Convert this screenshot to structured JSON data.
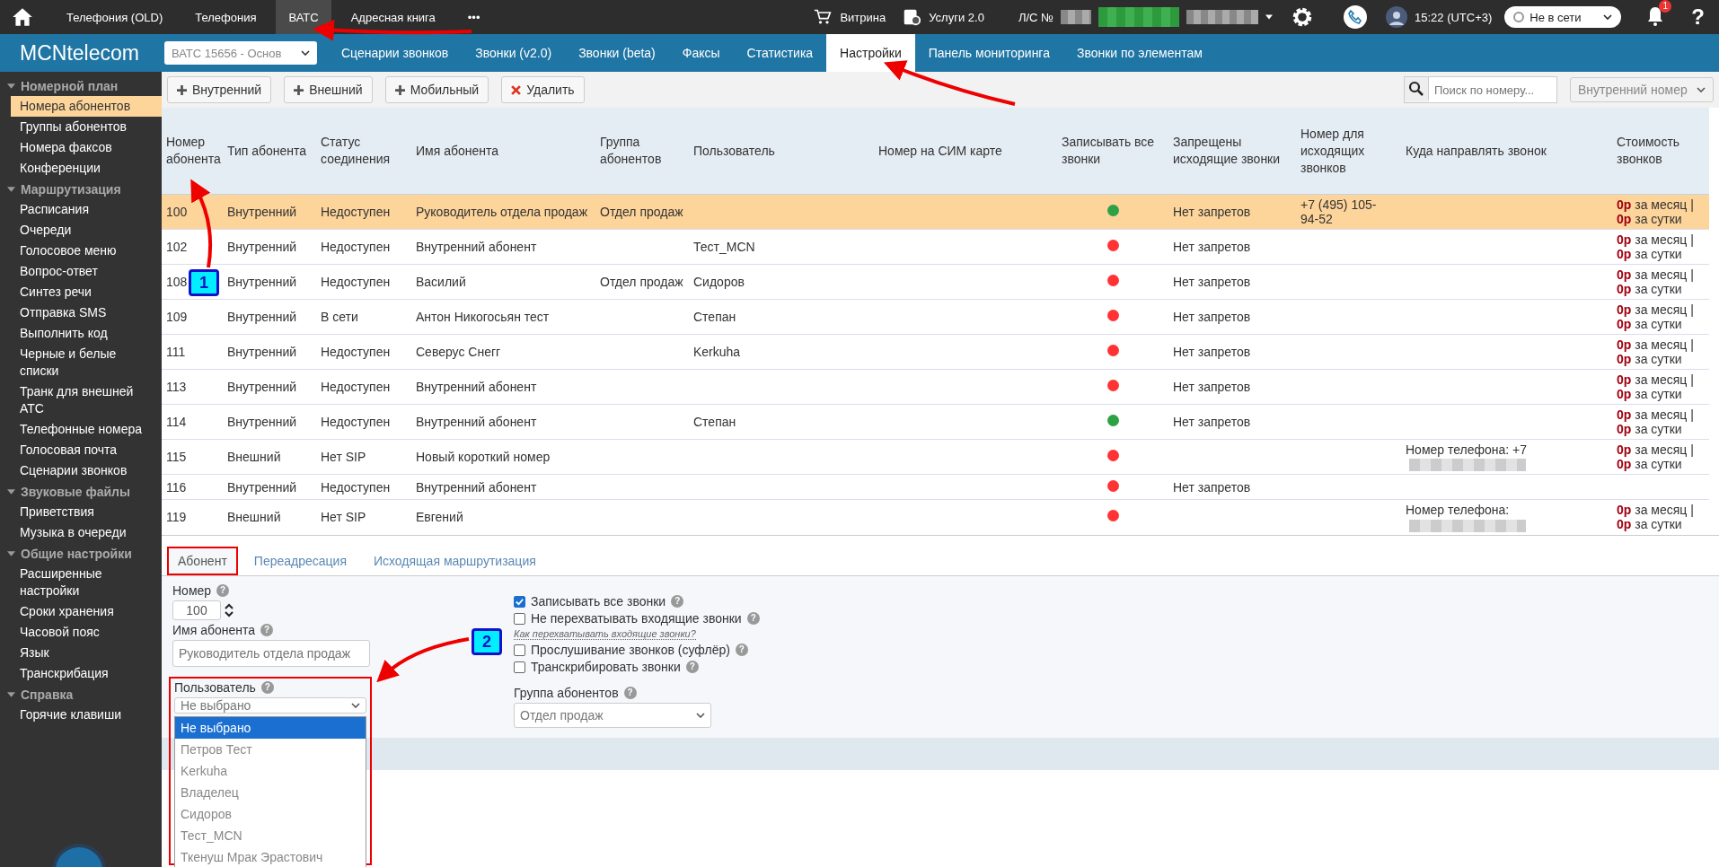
{
  "topbar": {
    "nav": [
      {
        "label": "Телефония (OLD)",
        "selected": false
      },
      {
        "label": "Телефония",
        "selected": false
      },
      {
        "label": "ВАТС",
        "selected": true
      },
      {
        "label": "Адресная книга",
        "selected": false
      },
      {
        "label": "•••",
        "selected": false
      }
    ],
    "showcase": "Витрина",
    "services": "Услуги 2.0",
    "account": "Л/С №",
    "time": "15:22 (UTC+3)",
    "status": "Не в сети",
    "notifications": "1",
    "help": "?"
  },
  "header": {
    "logo": "MCNtelecom",
    "pbx_select": "ВАТС 15656 - Основ",
    "tabs": [
      {
        "label": "Сценарии звонков",
        "selected": false
      },
      {
        "label": "Звонки (v2.0)",
        "selected": false
      },
      {
        "label": "Звонки (beta)",
        "selected": false
      },
      {
        "label": "Факсы",
        "selected": false
      },
      {
        "label": "Статистика",
        "selected": false
      },
      {
        "label": "Настройки",
        "selected": true
      },
      {
        "label": "Панель мониторинга",
        "selected": false
      },
      {
        "label": "Звонки по элементам",
        "selected": false
      }
    ]
  },
  "sidebar": {
    "groups": [
      {
        "title": "Номерной план",
        "expanded": true,
        "items": [
          {
            "label": "Номера абонентов",
            "selected": true
          },
          {
            "label": "Группы абонентов",
            "selected": false
          },
          {
            "label": "Номера факсов",
            "selected": false
          },
          {
            "label": "Конференции",
            "selected": false
          }
        ]
      },
      {
        "title": "Маршрутизация",
        "expanded": true,
        "items": [
          {
            "label": "Расписания",
            "selected": false
          },
          {
            "label": "Очереди",
            "selected": false
          },
          {
            "label": "Голосовое меню",
            "selected": false
          },
          {
            "label": "Вопрос-ответ",
            "selected": false
          },
          {
            "label": "Синтез речи",
            "selected": false
          },
          {
            "label": "Отправка SMS",
            "selected": false
          },
          {
            "label": "Выполнить код",
            "selected": false
          },
          {
            "label": "Черные и белые списки",
            "selected": false
          },
          {
            "label": "Транк для внешней АТС",
            "selected": false
          },
          {
            "label": "Телефонные номера",
            "selected": false
          },
          {
            "label": "Голосовая почта",
            "selected": false
          },
          {
            "label": "Сценарии звонков",
            "selected": false
          }
        ]
      },
      {
        "title": "Звуковые файлы",
        "expanded": true,
        "items": [
          {
            "label": "Приветствия",
            "selected": false
          },
          {
            "label": "Музыка в очереди",
            "selected": false
          }
        ]
      },
      {
        "title": "Общие настройки",
        "expanded": true,
        "items": [
          {
            "label": "Расширенные настройки",
            "selected": false
          },
          {
            "label": "Сроки хранения",
            "selected": false
          },
          {
            "label": "Часовой пояс",
            "selected": false
          },
          {
            "label": "Язык",
            "selected": false
          },
          {
            "label": "Транскрибация",
            "selected": false
          }
        ]
      },
      {
        "title": "Справка",
        "expanded": true,
        "items": [
          {
            "label": "Горячие клавиши",
            "selected": false
          }
        ]
      }
    ]
  },
  "toolbar": {
    "buttons": [
      {
        "label": "Внутренний",
        "kind": "add"
      },
      {
        "label": "Внешний",
        "kind": "add"
      },
      {
        "label": "Мобильный",
        "kind": "add"
      },
      {
        "label": "Удалить",
        "kind": "delete"
      }
    ],
    "search": {
      "placeholder": "Поиск по номеру..."
    },
    "filter": "Внутренний номер"
  },
  "table": {
    "columns": [
      "Номер абонента",
      "Тип абонента",
      "Статус соединения",
      "Имя абонента",
      "Группа абонентов",
      "Пользователь",
      "Номер на СИМ карте",
      "Записывать все звонки",
      "Запрещены исходящие звонки",
      "Номер для исходящих звонков",
      "Куда направлять звонок",
      "Стоимость звонков"
    ],
    "rows": [
      {
        "number": "100",
        "type": "Внутренний",
        "status": "Недоступен",
        "name": "Руководитель отдела продаж",
        "group": "Отдел продаж",
        "user": "",
        "record": true,
        "restrictions": "Нет запретов",
        "outgoing": "+7 (495) 105-94-52",
        "forward": "",
        "redacted": false,
        "cost": "**0р** за месяц | **0р** за сутки",
        "selected": true
      },
      {
        "number": "102",
        "type": "Внутренний",
        "status": "Недоступен",
        "name": "Внутренний абонент",
        "group": "",
        "user": "Тест_MCN",
        "record": false,
        "restrictions": "Нет запретов",
        "outgoing": "",
        "forward": "",
        "redacted": false,
        "cost": "**0р** за месяц | **0р** за сутки",
        "selected": false
      },
      {
        "number": "108",
        "type": "Внутренний",
        "status": "Недоступен",
        "name": "Василий",
        "group": "Отдел продаж",
        "user": "Сидоров",
        "record": false,
        "restrictions": "Нет запретов",
        "outgoing": "",
        "forward": "",
        "redacted": false,
        "cost": "**0р** за месяц | **0р** за сутки",
        "selected": false
      },
      {
        "number": "109",
        "type": "Внутренний",
        "status": "В сети",
        "name": "Антон Никогосьян тест",
        "group": "",
        "user": "Степан",
        "record": false,
        "restrictions": "Нет запретов",
        "outgoing": "",
        "forward": "",
        "redacted": false,
        "cost": "**0р** за месяц | **0р** за сутки",
        "selected": false
      },
      {
        "number": "111",
        "type": "Внутренний",
        "status": "Недоступен",
        "name": "Северус Снегг",
        "group": "",
        "user": "Kerkuha",
        "record": false,
        "restrictions": "Нет запретов",
        "outgoing": "",
        "forward": "",
        "redacted": false,
        "cost": "**0р** за месяц | **0р** за сутки",
        "selected": false
      },
      {
        "number": "113",
        "type": "Внутренний",
        "status": "Недоступен",
        "name": "Внутренний абонент",
        "group": "",
        "user": "",
        "record": false,
        "restrictions": "Нет запретов",
        "outgoing": "",
        "forward": "",
        "redacted": false,
        "cost": "**0р** за месяц | **0р** за сутки",
        "selected": false
      },
      {
        "number": "114",
        "type": "Внутренний",
        "status": "Недоступен",
        "name": "Внутренний абонент",
        "group": "",
        "user": "Степан",
        "record": true,
        "restrictions": "Нет запретов",
        "outgoing": "",
        "forward": "",
        "redacted": false,
        "cost": "**0р** за месяц | **0р** за сутки",
        "selected": false
      },
      {
        "number": "115",
        "type": "Внешний",
        "status": "Нет SIP",
        "name": "Новый короткий номер",
        "group": "",
        "user": "",
        "record": false,
        "restrictions": "",
        "outgoing": "",
        "forward": "Номер телефона: +7",
        "redacted": true,
        "cost": "**0р** за месяц | **0р** за сутки",
        "selected": false
      },
      {
        "number": "116",
        "type": "Внутренний",
        "status": "Недоступен",
        "name": "Внутренний абонент",
        "group": "",
        "user": "",
        "record": false,
        "restrictions": "Нет запретов",
        "outgoing": "",
        "forward": "",
        "redacted": false,
        "cost": "",
        "selected": false
      },
      {
        "number": "119",
        "type": "Внешний",
        "status": "Нет SIP",
        "name": "Евгений",
        "group": "",
        "user": "",
        "record": false,
        "restrictions": "",
        "outgoing": "",
        "forward": "Номер телефона:",
        "redacted": true,
        "cost": "**0р** за месяц | **0р** за сутки",
        "selected": false
      }
    ]
  },
  "details": {
    "tabs": [
      {
        "label": "Абонент",
        "selected": true,
        "highlighted": true
      },
      {
        "label": "Переадресация",
        "selected": false,
        "highlighted": false
      },
      {
        "label": "Исходящая маршрутизация",
        "selected": false,
        "highlighted": false
      }
    ],
    "number": {
      "label": "Номер",
      "help": "?",
      "value": "100"
    },
    "name": {
      "label": "Имя абонента",
      "help": "?",
      "placeholder": "Руководитель отдела продаж"
    },
    "user": {
      "label": "Пользователь",
      "help": "?",
      "value": "Не выбрано",
      "highlighted": true,
      "options": [
        {
          "label": "Не выбрано",
          "selected": true
        },
        {
          "label": "Петров Тест",
          "selected": false
        },
        {
          "label": "Kerkuha",
          "selected": false
        },
        {
          "label": "Владелец",
          "selected": false
        },
        {
          "label": "Сидоров",
          "selected": false
        },
        {
          "label": "Тест_MCN",
          "selected": false
        },
        {
          "label": "Ткенуш Мрак Эрастович",
          "selected": false
        }
      ]
    },
    "options": [
      {
        "kind": "checkbox",
        "label": "Записывать все звонки",
        "help": "?",
        "checked": true
      },
      {
        "kind": "checkbox",
        "label": "Не перехватывать входящие звонки",
        "help": "?",
        "checked": false
      },
      {
        "kind": "link",
        "label": "Как перехватывать входящие звонки?"
      },
      {
        "kind": "checkbox",
        "label": "Прослушивание звонков (суфлёр)",
        "help": "?",
        "checked": false
      },
      {
        "kind": "checkbox",
        "label": "Транскрибировать звонки",
        "help": "?",
        "checked": false
      }
    ],
    "group": {
      "label": "Группа абонентов",
      "help": "?",
      "value": "Отдел продаж"
    }
  },
  "annotations": [
    {
      "label": "1"
    },
    {
      "label": "2"
    }
  ]
}
